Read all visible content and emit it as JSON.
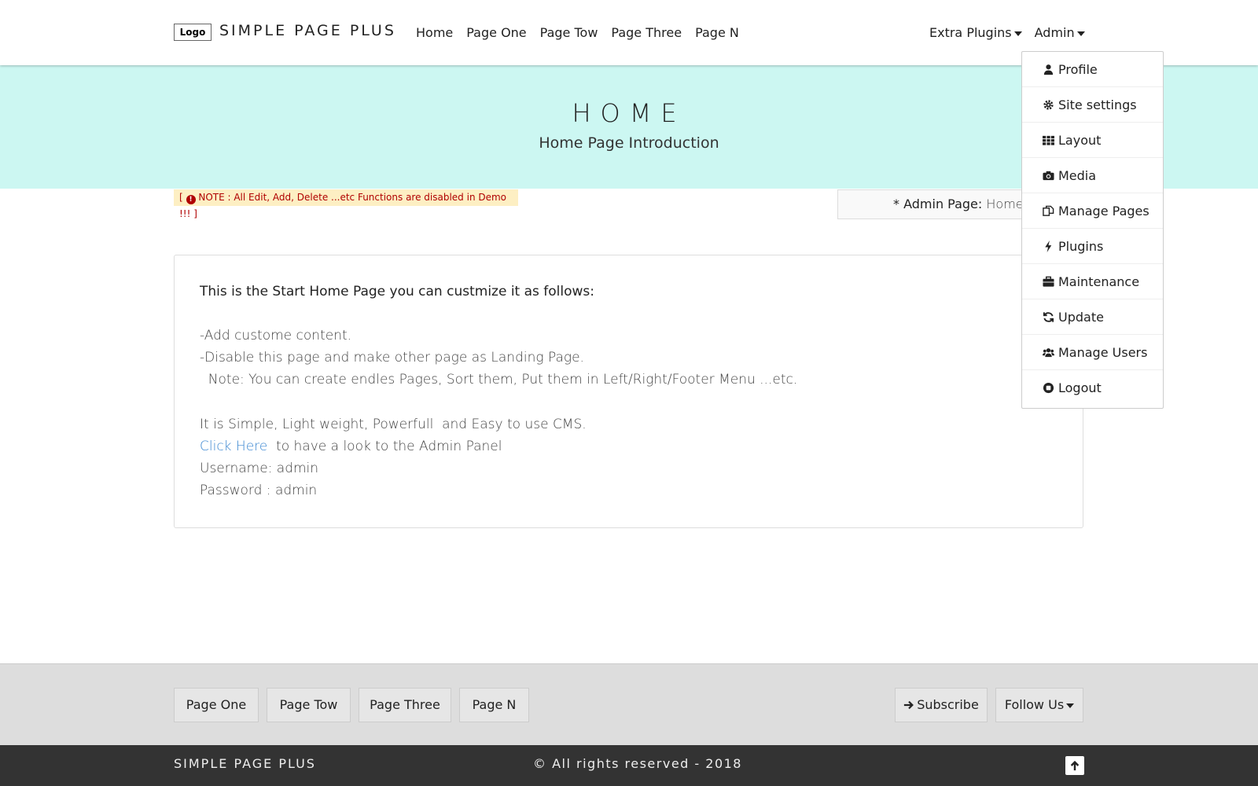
{
  "navbar": {
    "logo": "Logo",
    "brand": "SIMPLE PAGE PLUS",
    "links": [
      "Home",
      "Page One",
      "Page Tow",
      "Page Three",
      "Page N"
    ],
    "extra_plugins": "Extra Plugins",
    "admin": "Admin"
  },
  "hero": {
    "title": "HOME",
    "subtitle": "Home Page Introduction"
  },
  "note": {
    "prefix": "[",
    "icon": "exclamation-circle-icon",
    "text": "NOTE : All Edit, Add, Delete ...etc Functions are disabled in Demo !!! ]"
  },
  "admin_page": {
    "label": "* Admin Page:",
    "value": "Home"
  },
  "content": {
    "heading": "This is the Start Home Page you can custmize it as follows:",
    "line1": "-Add custome content.",
    "line2": "-Disable this page and make other page as Landing Page.",
    "line3": "  Note: You can create endles Pages, Sort them, Put them in Left/Right/Footer Menu ...etc.",
    "line4": "It is Simple, Light weight, Powerfull  and Easy to use CMS.",
    "link": "Click Here",
    "line5_rest": "  to have a look to the Admin Panel",
    "username": "Username: admin",
    "password": "Password : admin"
  },
  "dropdown": {
    "items": [
      {
        "label": "Profile",
        "icon": "user-icon"
      },
      {
        "label": "Site settings",
        "icon": "gear-icon"
      },
      {
        "label": "Layout",
        "icon": "grid-icon"
      },
      {
        "label": "Media",
        "icon": "camera-icon"
      },
      {
        "label": "Manage Pages",
        "icon": "copy-icon"
      },
      {
        "label": "Plugins",
        "icon": "bolt-icon"
      },
      {
        "label": "Maintenance",
        "icon": "briefcase-icon"
      },
      {
        "label": "Update",
        "icon": "refresh-icon"
      },
      {
        "label": "Manage Users",
        "icon": "users-icon"
      },
      {
        "label": "Logout",
        "icon": "stop-icon"
      }
    ]
  },
  "footer": {
    "links": [
      "Page One",
      "Page Tow",
      "Page Three",
      "Page N"
    ],
    "subscribe": "Subscribe",
    "follow": "Follow Us",
    "brand": "SIMPLE PAGE PLUS",
    "copyright": "© All rights reserved - 2018"
  }
}
